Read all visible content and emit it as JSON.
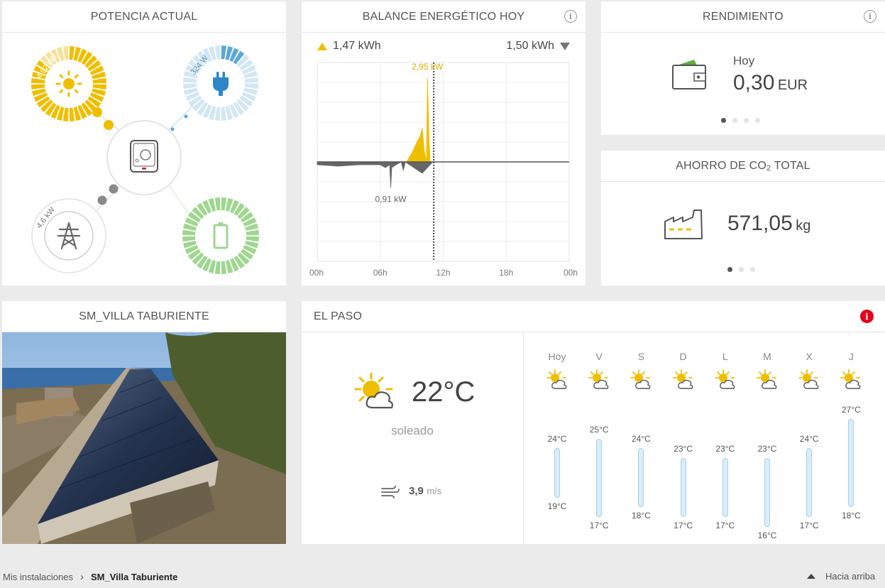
{
  "power": {
    "title": "POTENCIA ACTUAL",
    "pv_value": "4,92 kW",
    "consumption_value": "324 W",
    "grid_value": "4,6 kW",
    "pv_fill": 0.85,
    "consumption_fill": 0.1,
    "battery_fill": 1.0,
    "colors": {
      "pv": "#f0be00",
      "consumption": "#5ea7d8",
      "grid": "#8a8a8a",
      "battery": "#9fd690"
    }
  },
  "balance": {
    "title": "BALANCE ENERGÉTICO HOY",
    "produced": "1,47 kWh",
    "consumed": "1,50 kWh",
    "peak_label": "2,95 kW",
    "min_label": "0,91 kW"
  },
  "chart_data": {
    "type": "area",
    "title": "BALANCE ENERGÉTICO HOY",
    "x_ticks": [
      "00h",
      "06h",
      "12h",
      "18h",
      "00h"
    ],
    "current_time_hours": 11.1,
    "y_range_kw": [
      -3.5,
      3.5
    ],
    "series": [
      {
        "color": "#f0be00",
        "x": [
          7.0,
          8.5,
          9.0,
          9.5,
          9.8,
          10.0,
          10.2,
          10.4,
          10.5,
          10.65,
          10.75,
          10.9,
          11.0,
          11.5,
          12.0
        ],
        "y": [
          0,
          0,
          0.3,
          0.7,
          0.9,
          1.2,
          0.4,
          0.0,
          2.95,
          0.8,
          0.0,
          0,
          0,
          0,
          0
        ]
      },
      {
        "color": "#666666",
        "x": [
          0.0,
          2.0,
          4.0,
          6.0,
          6.5,
          6.9,
          7.0,
          7.1,
          7.5,
          8.0,
          8.2,
          8.4,
          10.0,
          11.0
        ],
        "y": [
          -0.1,
          -0.15,
          -0.1,
          -0.1,
          -0.2,
          -0.1,
          -0.91,
          -0.2,
          -0.1,
          0,
          -0.3,
          0,
          -0.4,
          0
        ]
      }
    ]
  },
  "yield": {
    "title": "RENDIMIENTO",
    "period": "Hoy",
    "value": "0,30",
    "unit": "EUR"
  },
  "co2": {
    "title_prefix": "AHORRO DE CO",
    "title_sub": "2",
    "title_suffix": " TOTAL",
    "value": "571,05",
    "unit": "kg"
  },
  "plant": {
    "title": "SM_VILLA TABURIENTE"
  },
  "weather": {
    "title": "EL PASO",
    "current_temp": "22°C",
    "condition": "soleado",
    "wind_value": "3,9",
    "wind_unit": "m/s",
    "forecast": [
      {
        "day": "Hoy",
        "max": "24°C",
        "min": "19°C",
        "max_n": 24,
        "min_n": 19
      },
      {
        "day": "V",
        "max": "25°C",
        "min": "17°C",
        "max_n": 25,
        "min_n": 17
      },
      {
        "day": "S",
        "max": "24°C",
        "min": "18°C",
        "max_n": 24,
        "min_n": 18
      },
      {
        "day": "D",
        "max": "23°C",
        "min": "17°C",
        "max_n": 23,
        "min_n": 17
      },
      {
        "day": "L",
        "max": "23°C",
        "min": "17°C",
        "max_n": 23,
        "min_n": 17
      },
      {
        "day": "M",
        "max": "23°C",
        "min": "16°C",
        "max_n": 23,
        "min_n": 16
      },
      {
        "day": "X",
        "max": "24°C",
        "min": "17°C",
        "max_n": 24,
        "min_n": 17
      },
      {
        "day": "J",
        "max": "27°C",
        "min": "18°C",
        "max_n": 27,
        "min_n": 18
      }
    ]
  },
  "footer": {
    "breadcrumb_root": "Mis instalaciones",
    "separator": "›",
    "breadcrumb_current": "SM_Villa Taburiente",
    "back_to_top": "Hacia arriba"
  }
}
